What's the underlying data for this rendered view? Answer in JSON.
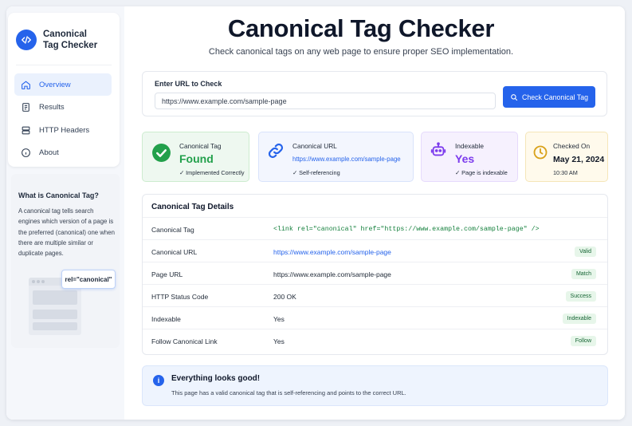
{
  "app": {
    "brand_line1": "Canonical",
    "brand_line2": "Tag Checker",
    "accent": "#2563eb"
  },
  "sidebar": {
    "items": [
      {
        "label": "Overview",
        "icon": "home-icon",
        "active": true
      },
      {
        "label": "Results",
        "icon": "document-icon",
        "active": false
      },
      {
        "label": "HTTP Headers",
        "icon": "server-icon",
        "active": false
      },
      {
        "label": "About",
        "icon": "info-icon",
        "active": false
      }
    ],
    "info": {
      "title": "What is Canonical Tag?",
      "text": "A canonical tag tells search engines which version of a page is the preferred (canonical) one when there are multiple similar or duplicate pages.",
      "illustration_label": "rel=\"canonical\""
    }
  },
  "header": {
    "title": "Canonical Tag Checker",
    "subtitle": "Check canonical tags on any web page to ensure proper SEO implementation."
  },
  "url_form": {
    "label": "Enter URL to Check",
    "value": "https://www.example.com/sample-page",
    "button_label": "Check Canonical Tag"
  },
  "stats": {
    "canonical_tag": {
      "label": "Canonical Tag",
      "value": "Found",
      "sub": "✓ Implemented Correctly",
      "color": "#22a04b"
    },
    "canonical_url": {
      "label": "Canonical URL",
      "value": "https://www.example.com/sample-page",
      "sub": "✓ Self-referencing",
      "color": "#2563eb"
    },
    "indexable": {
      "label": "Indexable",
      "value": "Yes",
      "sub": "✓ Page is indexable",
      "color": "#7c3aed"
    },
    "checked_on": {
      "label": "Checked On",
      "date": "May 21, 2024",
      "time": "10:30 AM",
      "color": "#d9a21b"
    }
  },
  "details": {
    "title": "Canonical Tag Details",
    "rows": [
      {
        "key": "Canonical Tag",
        "value": "<link rel=\"canonical\" href=\"https://www.example.com/sample-page\" />",
        "badge": ""
      },
      {
        "key": "Canonical URL",
        "value": "https://www.example.com/sample-page",
        "badge": "Valid"
      },
      {
        "key": "Page URL",
        "value": "https://www.example.com/sample-page",
        "badge": "Match"
      },
      {
        "key": "HTTP Status Code",
        "value": "200 OK",
        "badge": "Success"
      },
      {
        "key": "Indexable",
        "value": "Yes",
        "badge": "Indexable"
      },
      {
        "key": "Follow Canonical Link",
        "value": "Yes",
        "badge": "Follow"
      }
    ]
  },
  "alert": {
    "title": "Everything looks good!",
    "body": "This page has a valid canonical tag that is self-referencing and points to the correct URL.",
    "icon_text": "i"
  }
}
